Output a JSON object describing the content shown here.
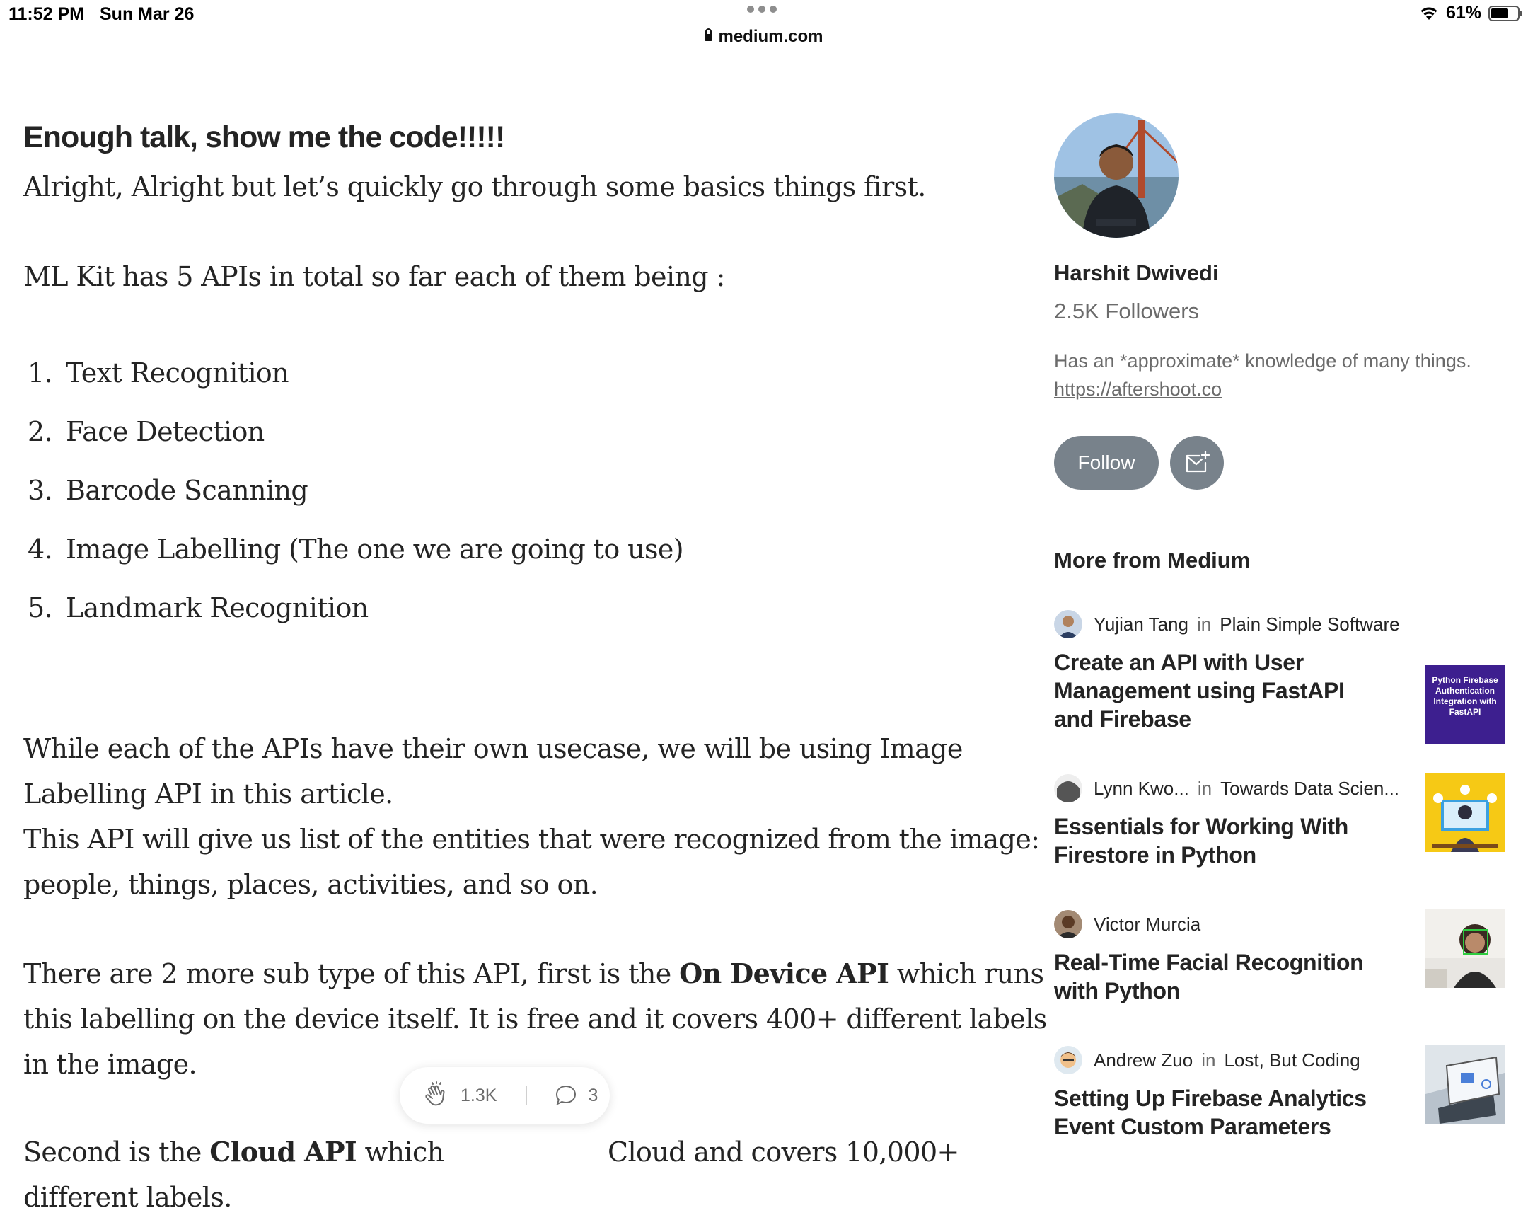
{
  "status_bar": {
    "time": "11:52 PM",
    "date": "Sun Mar 26",
    "url": "medium.com",
    "battery": "61%"
  },
  "article": {
    "heading": "Enough talk, show me the code!!!!!",
    "intro": "Alright, Alright but let’s quickly go through some basics things first.",
    "apis_lead": "ML Kit has 5 APIs in total so far each of them being :",
    "api_list": [
      {
        "num": "1.",
        "label": "Text Recognition"
      },
      {
        "num": "2.",
        "label": "Face Detection"
      },
      {
        "num": "3.",
        "label": "Barcode Scanning"
      },
      {
        "num": "4.",
        "label": "Image Labelling (The one we are going to use)"
      },
      {
        "num": "5.",
        "label": "Landmark Recognition"
      }
    ],
    "para1_line1": "While each of the APIs have their own usecase, we will be using Image",
    "para1_line2": "Labelling API in this article.",
    "para1_line3": "This API will give us list of the entities that were recognized from the image:",
    "para1_line4": "people, things, places, activities, and so on.",
    "para2_line1_a": "There are 2 more sub type of this API, first is the ",
    "para2_line1_b": "On Device API",
    "para2_line1_c": " which runs",
    "para2_line2": "this labelling on the device itself. It is free and it covers 400+ different labels",
    "para2_line3": "in the image.",
    "para3_a": "Second is the ",
    "para3_b": "Cloud API",
    "para3_c": " which",
    "para3_d": "Cloud and covers 10,000+",
    "para3_line2": "different labels."
  },
  "floating_bar": {
    "claps": "1.3K",
    "responses": "3"
  },
  "sidebar": {
    "author_name": "Harshit Dwivedi",
    "followers": "2.5K Followers",
    "bio": "Has an *approximate* knowledge of many things.",
    "bio_link": "https://aftershoot.co",
    "follow_label": "Follow",
    "more_title": "More from Medium",
    "stories": [
      {
        "author": "Yujian Tang",
        "in": "in",
        "publication": "Plain Simple Software",
        "title": "Create an API with User Management using FastAPI and Firebase",
        "thumb_text": "Python Firebase Authentication Integration with FastAPI"
      },
      {
        "author": "Lynn Kwo...",
        "in": "in",
        "publication": "Towards Data Scien...",
        "title": "Essentials for Working With Firestore in Python"
      },
      {
        "author": "Victor Murcia",
        "in": "",
        "publication": "",
        "title": "Real-Time Facial Recognition with Python"
      },
      {
        "author": "Andrew Zuo",
        "in": "in",
        "publication": "Lost, But Coding",
        "title": "Setting Up Firebase Analytics Event Custom Parameters"
      }
    ]
  },
  "colors": {
    "text": "#242424",
    "muted": "#6b6b6b",
    "follow_button": "#78828b",
    "thumb_purple": "#3d1f8f",
    "thumb_yellow": "#f6c915"
  }
}
